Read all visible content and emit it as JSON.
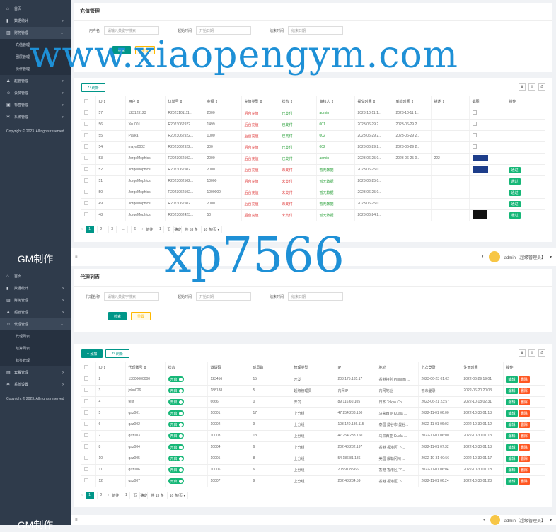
{
  "brand": "GM制作",
  "nav": {
    "home": "首页",
    "stats": "数据统计",
    "finance": "财务管理",
    "recharge": "充值管理",
    "circle": "圈层管理",
    "ops": "操作管理",
    "audit": "超管管理",
    "member": "会员管理",
    "agent": "代理管理",
    "agent_list": "代理列表",
    "settle": "结算列表",
    "tags": "标签管理",
    "system": "系统管理",
    "gm": "套餐管理",
    "settings": "系统设置"
  },
  "copyright": "Copyright © 2023. All rights reserved",
  "top_user": "admin【超级管理员】",
  "recharge": {
    "title": "充值管理",
    "f_user": "用户名",
    "f_user_ph": "请输入关键字搜索",
    "f_start": "起始时间",
    "f_start_ph": "开始日期",
    "f_end": "结束时间",
    "f_end_ph": "结束日期",
    "search": "检索",
    "reset": "重置",
    "refresh": "刷新",
    "cols": [
      "ID",
      "用户",
      "订单号",
      "金额",
      "充值类型",
      "状态",
      "审核人",
      "提交时间",
      "到款时间",
      "描述",
      "截图",
      "操作"
    ],
    "rows": [
      [
        "57",
        "123123123",
        "R2023101111...",
        "2000",
        "后台充值",
        "已支付",
        "admin",
        "2023-10-11 1...",
        "2023-10-11 1...",
        "",
        "ph",
        ""
      ],
      [
        "56",
        "Yeu001",
        "R2023062922...",
        "1499",
        "后台充值",
        "已支付",
        "001",
        "2023-06-29 2...",
        "2023-06-29 2...",
        "",
        "ph",
        ""
      ],
      [
        "55",
        "Pavka",
        "R2023062922...",
        "1000",
        "后台充值",
        "已支付",
        "002",
        "2023-06-29 2...",
        "2023-06-29 2...",
        "",
        "ph",
        ""
      ],
      [
        "54",
        "maya0002",
        "R2023062922...",
        "300",
        "后台充值",
        "已支付",
        "002",
        "2023-06-29 2...",
        "2023-06-29 2...",
        "",
        "ph",
        ""
      ],
      [
        "53",
        "JorgeMophics",
        "R2023062502...",
        "2000",
        "后台充值",
        "已支付",
        "admin",
        "2023-06-25 0...",
        "2023-06-25 0...",
        "222",
        "blue",
        ""
      ],
      [
        "52",
        "JorgeMophics",
        "R2023062502...",
        "2000",
        "后台充值",
        "未支付",
        "暂无数据",
        "2023-06-25 0...",
        "",
        "",
        "blue",
        "通过"
      ],
      [
        "51",
        "JorgeMophics",
        "R2023062502...",
        "10000",
        "后台充值",
        "未支付",
        "暂无数据",
        "2023-06-25 0...",
        "",
        "",
        "",
        "通过"
      ],
      [
        "50",
        "JorgeMophics",
        "R2023062502...",
        "1000000",
        "后台充值",
        "未支付",
        "暂无数据",
        "2023-06-25 0...",
        "",
        "",
        "",
        "通过"
      ],
      [
        "49",
        "JorgeMophics",
        "R2023062502...",
        "2000",
        "后台充值",
        "未支付",
        "暂无数据",
        "2023-06-25 0...",
        "",
        "",
        "",
        "通过"
      ],
      [
        "48",
        "JorgeMophics",
        "R2023062423...",
        "50",
        "后台充值",
        "未支付",
        "暂无数据",
        "2023-06-24 2...",
        "",
        "",
        "dark",
        "通过"
      ]
    ],
    "pager": {
      "pages": [
        "1",
        "2",
        "3",
        "...",
        "6"
      ],
      "next": "前往",
      "page_val": "1",
      "page_word": "页",
      "confirm": "确定",
      "total": "共 53 条",
      "per": "10 条/页"
    }
  },
  "agent": {
    "title": "代理列表",
    "f_name": "代理名称",
    "f_name_ph": "请输入关键字搜索",
    "f_start": "起始时间",
    "f_start_ph": "开始日期",
    "f_end": "结束时间",
    "f_end_ph": "结束日期",
    "search": "检索",
    "reset": "重置",
    "add": "添加",
    "refresh": "刷新",
    "cols": [
      "ID",
      "代理账号",
      "状态",
      "邀请码",
      "成员数",
      "管理类型",
      "IP",
      "地址",
      "上次登录",
      "注册时间",
      "操作"
    ],
    "switch_label": "开启",
    "edit": "编辑",
    "del": "删除",
    "rows": [
      [
        "2",
        "13000000000",
        "123456",
        "15",
        "开发",
        "203.175.135.17",
        "香港特别 Pinnum ...",
        "2023-06-23 01:02",
        "2022-06-29 19:01"
      ],
      [
        "3",
        "john026",
        "188188",
        "5",
        "超级管理员",
        "内网IP",
        "内网地址",
        "暂未登录",
        "2022-06-20 20:03"
      ],
      [
        "4",
        "test",
        "6666",
        "0",
        "开发",
        "89.116.60.105",
        "日本 Tokyo Chi...",
        "2023-06-21 23:57",
        "2022-10-18 02:31"
      ],
      [
        "5",
        "qaz001",
        "10001",
        "17",
        "上分组",
        "47.254.238.160",
        "马来西亚 Kuala ...",
        "2022-11-01 06:00",
        "2022-10-30 01:13"
      ],
      [
        "6",
        "qaz002",
        "10002",
        "9",
        "上分组",
        "103.140.186.115",
        "泰国 曼谷市 曼谷...",
        "2022-11-01 06:03",
        "2022-10-30 01:12"
      ],
      [
        "7",
        "qaz003",
        "10003",
        "13",
        "上分组",
        "47.254.238.160",
        "马来西亚 Kuala ...",
        "2022-11-01 06:00",
        "2022-10-30 01:13"
      ],
      [
        "8",
        "qaz004",
        "10004",
        "6",
        "上分组",
        "202.43.232.197",
        "香港 香港区 下...",
        "2022-11-01 07:32",
        "2022-10-30 01:13"
      ],
      [
        "10",
        "qaz005",
        "10005",
        "8",
        "上分组",
        "54.186.81.186",
        "美国 俄勒冈州 ...",
        "2022-10-31 00:56",
        "2022-10-30 01:17"
      ],
      [
        "11",
        "qaz006",
        "10006",
        "6",
        "上分组",
        "203.91.85.66",
        "香港 香港区 下...",
        "2022-11-01 06:04",
        "2022-10-30 01:18"
      ],
      [
        "12",
        "qaz007",
        "10007",
        "9",
        "上分组",
        "202.43.234.59",
        "香港 香港区 下...",
        "2022-11-01 06:24",
        "2022-10-30 01:23"
      ]
    ],
    "pager": {
      "pages": [
        "1",
        "2"
      ],
      "next": "前往",
      "page_val": "1",
      "page_word": "页",
      "confirm": "确定",
      "total": "共 13 条",
      "per": "10 条/页"
    }
  },
  "watermarks": {
    "w1": "www.xiaopengym.com",
    "w2": "xp7566"
  }
}
